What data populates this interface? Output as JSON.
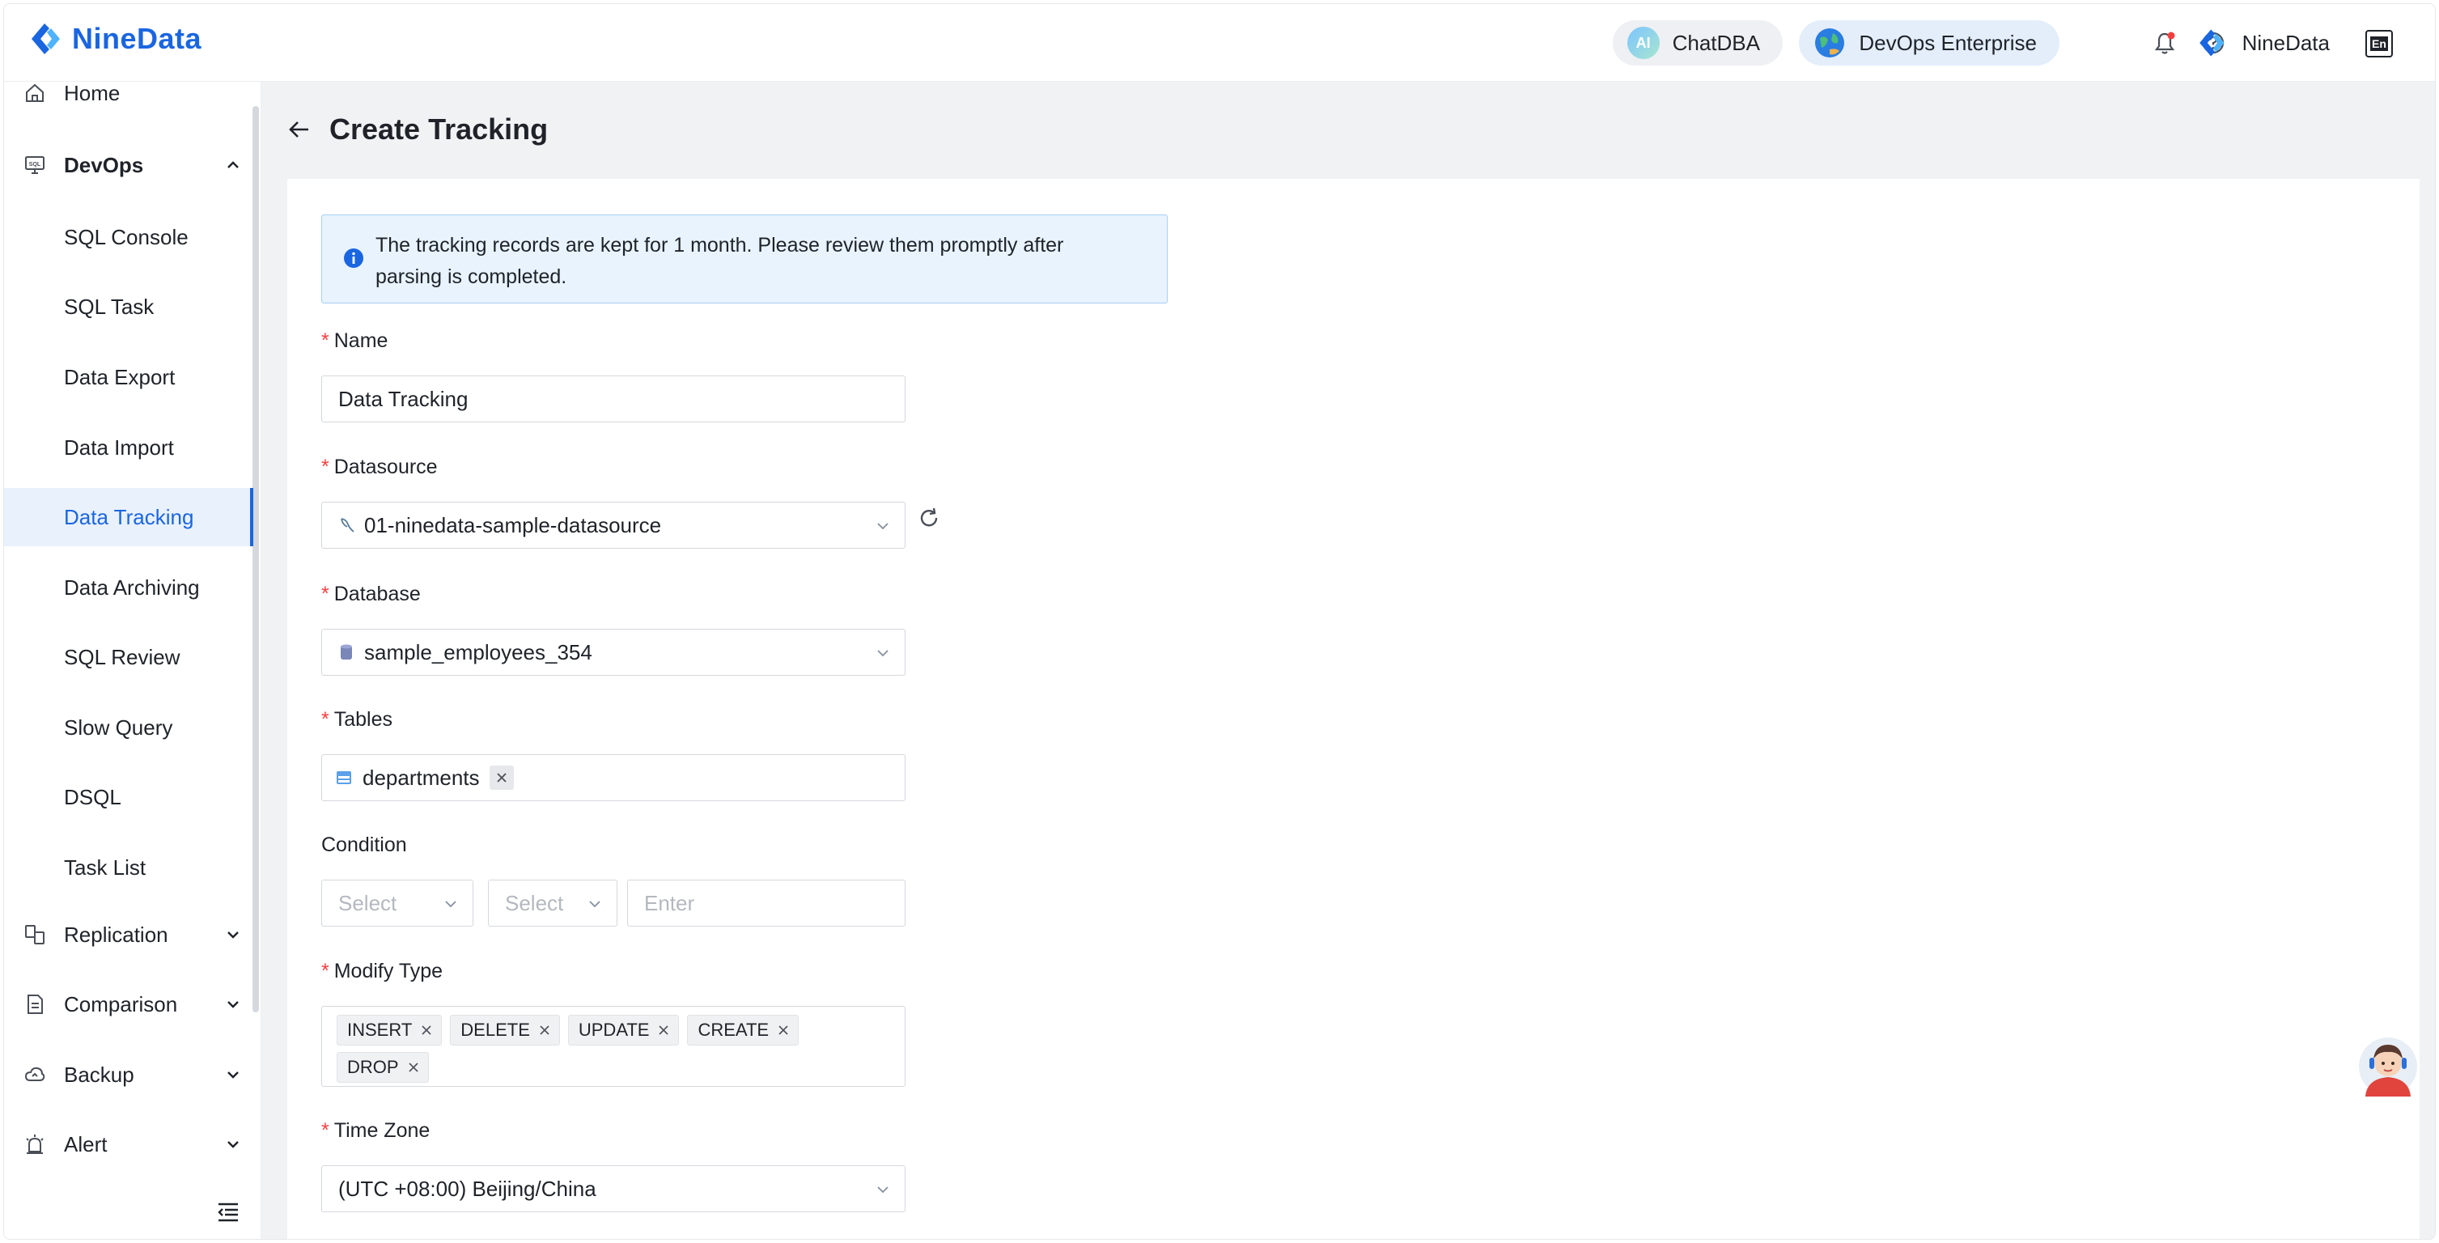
{
  "header": {
    "logo_text": "NineData",
    "chatdba_label": "ChatDBA",
    "chatdba_badge": "AI",
    "enterprise_label": "DevOps Enterprise",
    "user_name": "NineData",
    "lang_icon_text": "En"
  },
  "sidebar": {
    "home": "Home",
    "devops": "DevOps",
    "sub_items": [
      "SQL Console",
      "SQL Task",
      "Data Export",
      "Data Import",
      "Data Tracking",
      "Data Archiving",
      "SQL Review",
      "Slow Query",
      "DSQL",
      "Task List"
    ],
    "active": "Data Tracking",
    "replication": "Replication",
    "comparison": "Comparison",
    "backup": "Backup",
    "alert": "Alert"
  },
  "page": {
    "title": "Create Tracking",
    "notice_line1": "The tracking records are kept for 1 month. Please review them promptly after",
    "notice_line2": "parsing is completed."
  },
  "form": {
    "name_label": "Name",
    "name_value": "Data Tracking",
    "datasource_label": "Datasource",
    "datasource_value": "01-ninedata-sample-datasource",
    "database_label": "Database",
    "database_value": "sample_employees_354",
    "tables_label": "Tables",
    "tables": [
      "departments"
    ],
    "condition_label": "Condition",
    "condition_select1_placeholder": "Select",
    "condition_select2_placeholder": "Select",
    "condition_input_placeholder": "Enter",
    "modify_type_label": "Modify Type",
    "modify_types": [
      "INSERT",
      "DELETE",
      "UPDATE",
      "CREATE",
      "DROP"
    ],
    "timezone_label": "Time Zone",
    "timezone_value": "(UTC +08:00) Beijing/China"
  },
  "colors": {
    "accent": "#1a66e0",
    "required": "#f53f3f",
    "notice_bg": "#e8f3fd"
  }
}
